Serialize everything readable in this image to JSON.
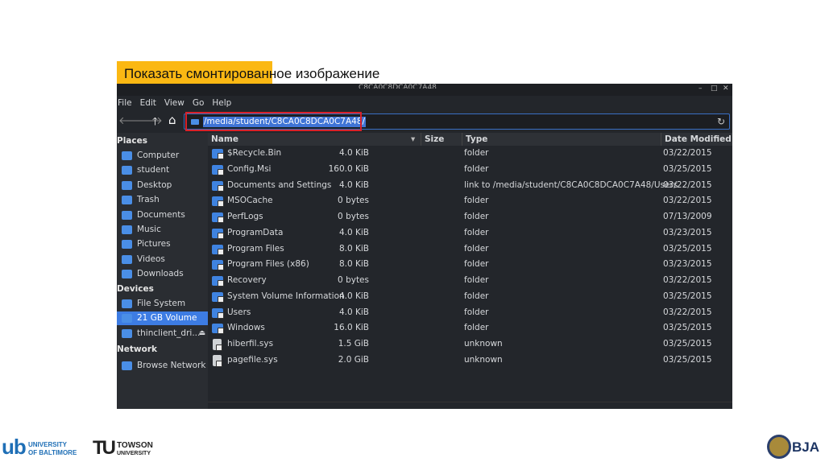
{
  "slide": {
    "title": "Показать смонтированное изображение"
  },
  "window": {
    "title": "C8CA0C8DCA0C7A48",
    "controls": [
      "–",
      "□",
      "✕"
    ]
  },
  "menu": [
    "File",
    "Edit",
    "View",
    "Go",
    "Help"
  ],
  "toolbar": {
    "back": "🡐",
    "forward": "🡒",
    "up": "🡑",
    "home": "⌂",
    "path": "/media/student/C8CA0C8DCA0C7A48/",
    "reload": "↻"
  },
  "sidebar": {
    "places_label": "Places",
    "places": [
      "Computer",
      "student",
      "Desktop",
      "Trash",
      "Documents",
      "Music",
      "Pictures",
      "Videos",
      "Downloads"
    ],
    "devices_label": "Devices",
    "devices": [
      "File System",
      "21 GB Volume",
      "thinclient_dri..."
    ],
    "eject": "⏏",
    "network_label": "Network",
    "network": [
      "Browse Network"
    ]
  },
  "columns": {
    "name": "Name",
    "size": "Size",
    "type": "Type",
    "date": "Date Modified",
    "sort": "▾"
  },
  "files": [
    {
      "name": "$Recycle.Bin",
      "size": "4.0 KiB",
      "type": "folder",
      "date": "03/22/2015",
      "kind": "folder"
    },
    {
      "name": "Config.Msi",
      "size": "160.0 KiB",
      "type": "folder",
      "date": "03/25/2015",
      "kind": "folder"
    },
    {
      "name": "Documents and Settings",
      "size": "4.0 KiB",
      "type": "link to /media/student/C8CA0C8DCA0C7A48/Users",
      "date": "03/22/2015",
      "kind": "folder"
    },
    {
      "name": "MSOCache",
      "size": "0 bytes",
      "type": "folder",
      "date": "03/22/2015",
      "kind": "folder"
    },
    {
      "name": "PerfLogs",
      "size": "0 bytes",
      "type": "folder",
      "date": "07/13/2009",
      "kind": "folder"
    },
    {
      "name": "ProgramData",
      "size": "4.0 KiB",
      "type": "folder",
      "date": "03/23/2015",
      "kind": "folder"
    },
    {
      "name": "Program Files",
      "size": "8.0 KiB",
      "type": "folder",
      "date": "03/25/2015",
      "kind": "folder"
    },
    {
      "name": "Program Files (x86)",
      "size": "8.0 KiB",
      "type": "folder",
      "date": "03/23/2015",
      "kind": "folder"
    },
    {
      "name": "Recovery",
      "size": "0 bytes",
      "type": "folder",
      "date": "03/22/2015",
      "kind": "folder"
    },
    {
      "name": "System Volume Information",
      "size": "4.0 KiB",
      "type": "folder",
      "date": "03/25/2015",
      "kind": "folder"
    },
    {
      "name": "Users",
      "size": "4.0 KiB",
      "type": "folder",
      "date": "03/22/2015",
      "kind": "folder"
    },
    {
      "name": "Windows",
      "size": "16.0 KiB",
      "type": "folder",
      "date": "03/25/2015",
      "kind": "folder"
    },
    {
      "name": "hiberfil.sys",
      "size": "1.5 GiB",
      "type": "unknown",
      "date": "03/25/2015",
      "kind": "file"
    },
    {
      "name": "pagefile.sys",
      "size": "2.0 GiB",
      "type": "unknown",
      "date": "03/25/2015",
      "kind": "file"
    }
  ],
  "footer": {
    "ub_mark": "ub",
    "ub_text1": "UNIVERSITY",
    "ub_text2": "OF BALTIMORE",
    "tu_mark": "TU",
    "tu_text1": "TOWSON",
    "tu_text2": "UNIVERSITY",
    "bja": "BJA"
  }
}
